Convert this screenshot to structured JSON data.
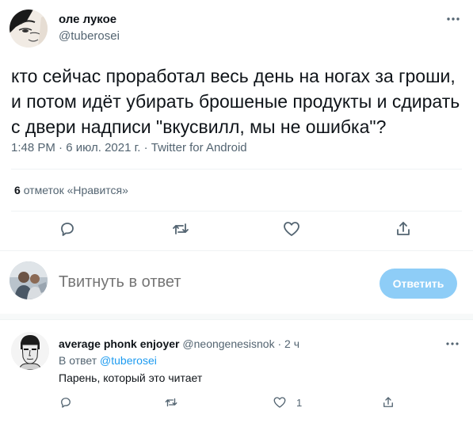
{
  "tweet": {
    "author_name": "оле лукое",
    "author_handle": "@tuberosei",
    "text": "кто сейчас проработал весь день на ногах за гроши, и потом идёт убирать брошеные продукты и сдирать с двери надписи \"вкусвилл, мы не ошибка\"?",
    "meta": "1:48 PM · 6 июл. 2021 г. · Twitter for Android",
    "likes_count": "6",
    "likes_label": "отметок «Нравится»"
  },
  "icons": {
    "more": "more-horizontal-icon",
    "reply": "reply-bubble-icon",
    "retweet": "retweet-icon",
    "like": "heart-icon",
    "share": "share-icon"
  },
  "composer": {
    "placeholder": "Твитнуть в ответ",
    "button_label": "Ответить"
  },
  "reply": {
    "author_name": "average phonk enjoyer",
    "author_handle": "@neongenesisnok",
    "separator": "·",
    "time": "2 ч",
    "reply_to_prefix": "В ответ",
    "reply_to_handle": "@tuberosei",
    "text": "Парень, который это читает",
    "like_count": "1"
  },
  "colors": {
    "accent": "#1d9bf0",
    "button_disabled": "#8ecdf7",
    "secondary_text": "#536471",
    "divider": "#eff3f4"
  }
}
